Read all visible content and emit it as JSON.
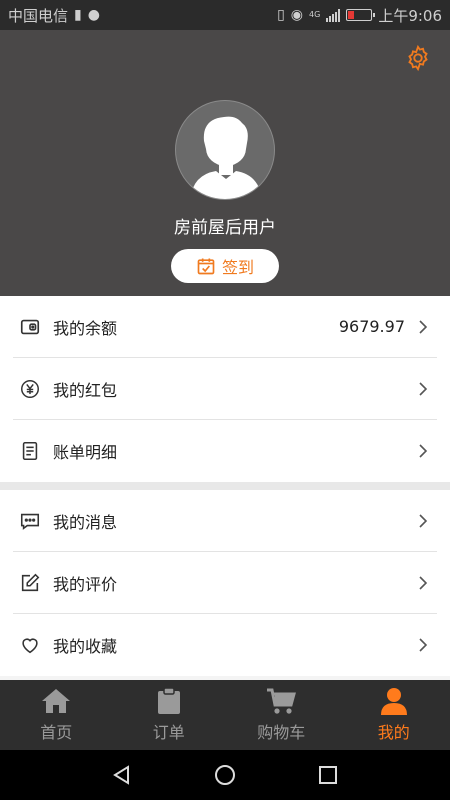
{
  "status_bar": {
    "carrier": "中国电信",
    "time": "上午9:06",
    "signal_label": "4G",
    "battery_level": 0.2
  },
  "header": {
    "username": "房前屋后用户",
    "checkin_label": "签到",
    "accent_color": "#f07a1f"
  },
  "menu_groups": [
    {
      "items": [
        {
          "label": "我的余额",
          "value": "9679.97",
          "icon": "wallet-icon"
        },
        {
          "label": "我的红包",
          "value": "",
          "icon": "yuan-coin-icon"
        },
        {
          "label": "账单明细",
          "value": "",
          "icon": "document-icon"
        }
      ]
    },
    {
      "items": [
        {
          "label": "我的消息",
          "value": "",
          "icon": "message-icon"
        },
        {
          "label": "我的评价",
          "value": "",
          "icon": "edit-icon"
        },
        {
          "label": "我的收藏",
          "value": "",
          "icon": "heart-icon"
        }
      ]
    }
  ],
  "bottom_nav": {
    "items": [
      {
        "label": "首页",
        "icon": "home-icon",
        "active": false
      },
      {
        "label": "订单",
        "icon": "clipboard-icon",
        "active": false
      },
      {
        "label": "购物车",
        "icon": "cart-icon",
        "active": false
      },
      {
        "label": "我的",
        "icon": "person-icon",
        "active": true
      }
    ]
  },
  "system_nav": {
    "buttons": [
      "back-icon",
      "home-circle-icon",
      "recents-icon"
    ]
  }
}
